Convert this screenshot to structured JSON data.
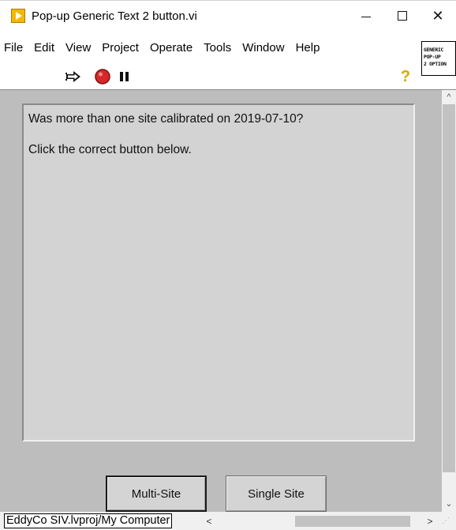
{
  "window": {
    "title": "Pop-up Generic Text 2 button.vi",
    "controls": {
      "minimize": "—",
      "maximize": "☐",
      "close": "✕"
    }
  },
  "menu": [
    "File",
    "Edit",
    "View",
    "Project",
    "Operate",
    "Tools",
    "Window",
    "Help"
  ],
  "toolbar": {
    "icons": [
      "run-arrow-icon",
      "abort-execution-icon",
      "pause-icon",
      "context-help-icon"
    ],
    "help_glyph": "?"
  },
  "vi_icon_text": [
    "GENERIC",
    "POP-UP",
    "2 OPTION"
  ],
  "message": {
    "line1": "Was more than one site calibrated on 2019-07-10?",
    "line2": "Click the correct button below."
  },
  "buttons": {
    "multi": "Multi-Site",
    "single": "Single Site"
  },
  "status": {
    "context": "EddyCo SIV.lvproj/My Computer"
  },
  "scroll": {
    "up": "^",
    "down": "⌄",
    "left": "<",
    "right": ">"
  },
  "colors": {
    "panel": "#bdbdbd",
    "message_box": "#d3d3d3",
    "abort": "#d62828",
    "help": "#d8a800"
  }
}
